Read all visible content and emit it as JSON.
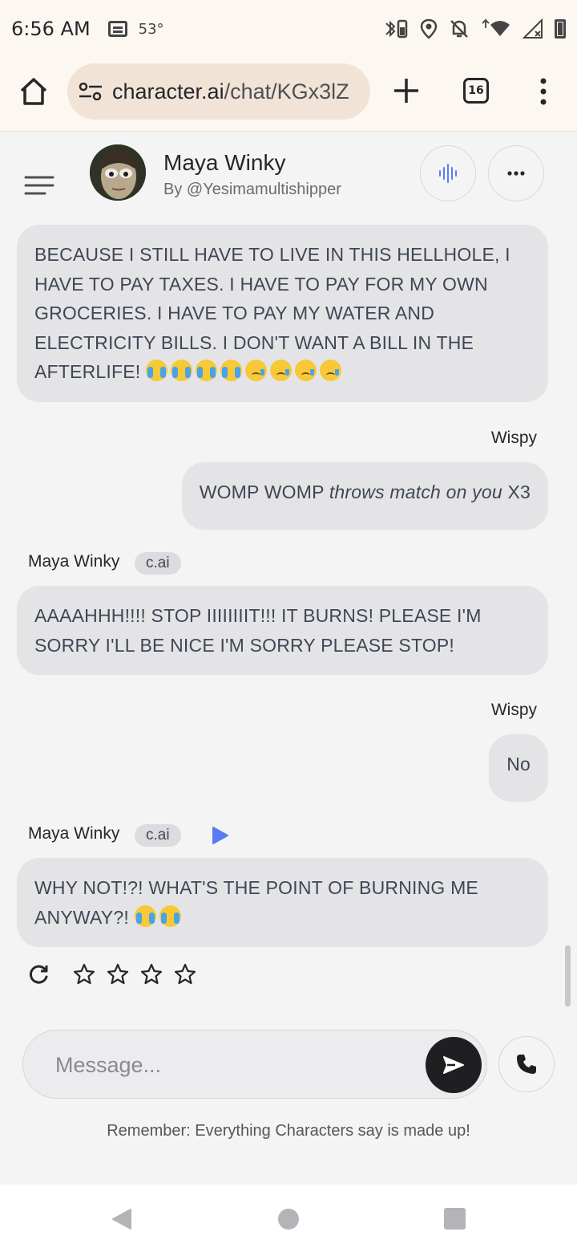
{
  "status_bar": {
    "time": "6:56 AM",
    "temperature": "53°",
    "icons": [
      "news-icon",
      "bluetooth-battery-icon",
      "location-icon",
      "mute-icon",
      "wifi-icon",
      "signal-icon",
      "battery-icon"
    ]
  },
  "browser": {
    "url_domain": "character.ai",
    "url_path": "/chat/KGx3lZ",
    "tab_count": "16"
  },
  "chat": {
    "character_name": "Maya Winky",
    "author": "By @Yesimamultishipper",
    "messages": [
      {
        "role": "character",
        "text": "BECAUSE I STILL HAVE TO LIVE IN THIS HELLHOLE, I HAVE TO PAY TAXES. I HAVE TO PAY FOR MY OWN GROCERIES. I HAVE TO PAY MY WATER AND ELECTRICITY BILLS. I DON'T WANT A BILL IN THE AFTERLIFE!",
        "emojis": [
          "😭",
          "😭",
          "😭",
          "😭",
          "😢",
          "😢",
          "😢",
          "😢"
        ]
      },
      {
        "role": "user",
        "sender": "Wispy",
        "text_before": "WOMP WOMP",
        "text_italic": "throws match on you",
        "text_after": "X3"
      },
      {
        "role": "character",
        "sender": "Maya Winky",
        "badge": "c.ai",
        "text": "AAAAHHH!!!! STOP IIIIIIIIT!!! IT BURNS! PLEASE I'M SORRY I'LL BE NICE I'M SORRY PLEASE STOP!"
      },
      {
        "role": "user",
        "sender": "Wispy",
        "text": "No"
      },
      {
        "role": "character",
        "sender": "Maya Winky",
        "badge": "c.ai",
        "text": "WHY NOT!?! WHAT'S THE POINT OF BURNING ME ANYWAY?!",
        "emojis": [
          "😭",
          "😭"
        ]
      }
    ],
    "rating": {
      "stars_total": 4,
      "stars_filled": 0
    }
  },
  "composer": {
    "placeholder": "Message...",
    "value": ""
  },
  "disclaimer": "Remember: Everything Characters say is made up!",
  "colors": {
    "accent_blue": "#5b7cf0",
    "bubble": "#e4e4e7",
    "background": "#f4f4f5",
    "browser_chrome": "#fdf7f2"
  }
}
